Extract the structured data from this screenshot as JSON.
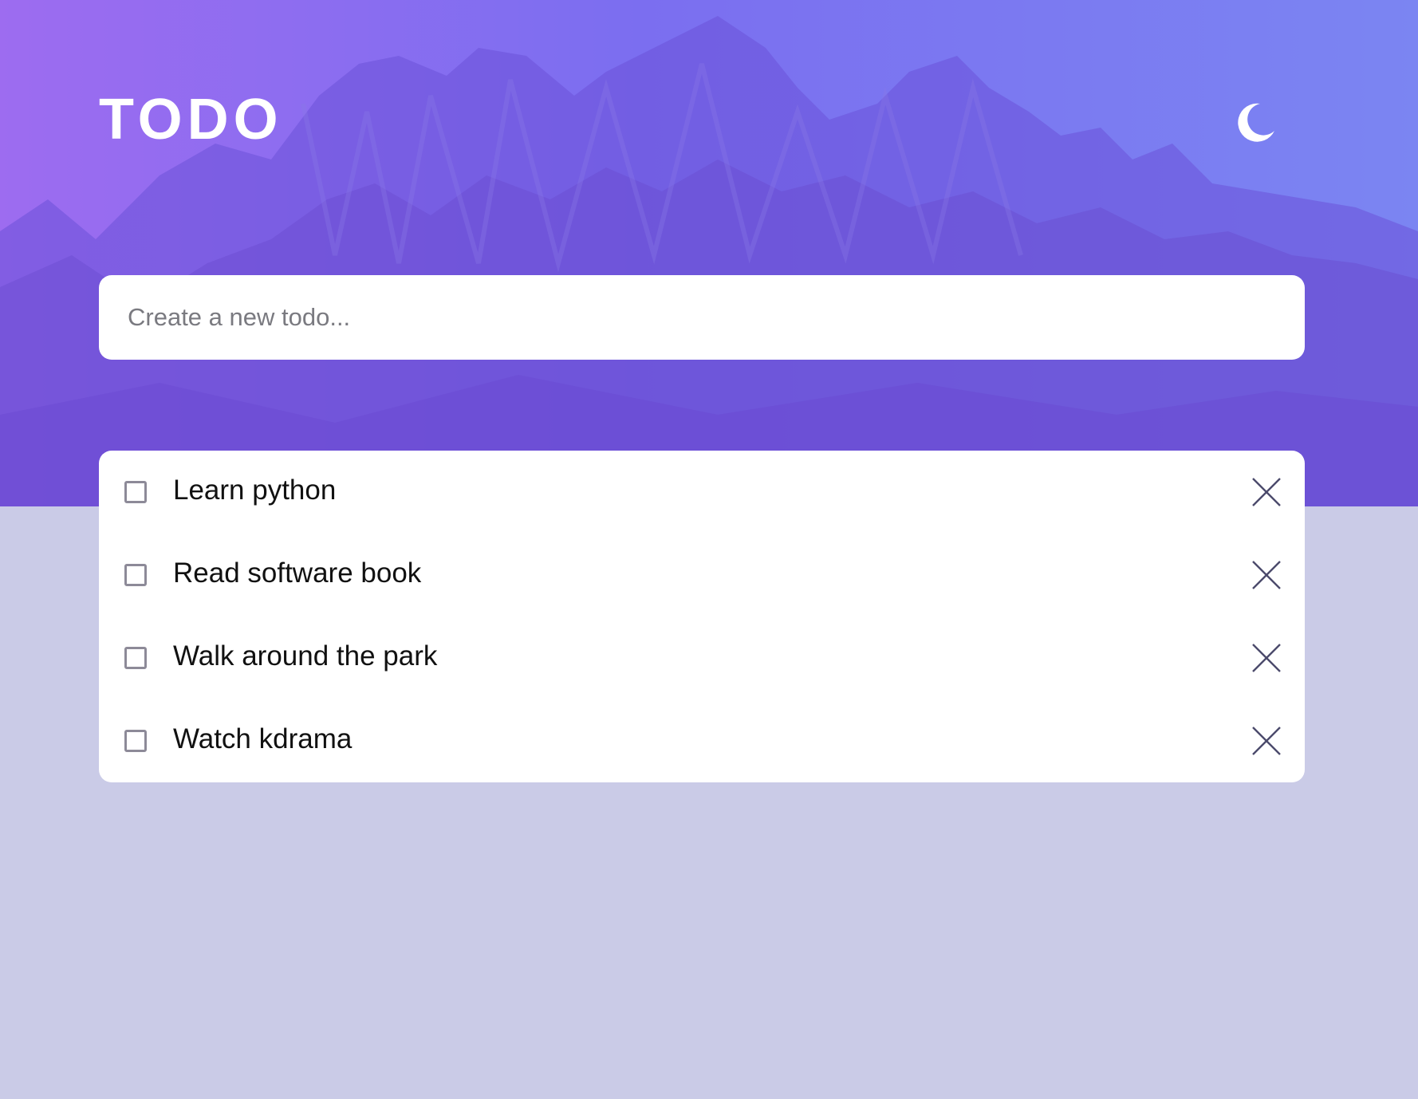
{
  "app": {
    "title": "TODO",
    "theme_icon": "moon-icon"
  },
  "new_todo": {
    "placeholder": "Create a new todo..."
  },
  "todos": [
    {
      "text": "Learn python",
      "completed": false
    },
    {
      "text": "Read software book",
      "completed": false
    },
    {
      "text": "Walk around the park",
      "completed": false
    },
    {
      "text": "Watch kdrama",
      "completed": false
    }
  ],
  "colors": {
    "page_background": "#cacbe7",
    "hero_gradient_start": "#9d6cf0",
    "hero_gradient_end": "#7b85f2",
    "card_background": "#ffffff"
  }
}
